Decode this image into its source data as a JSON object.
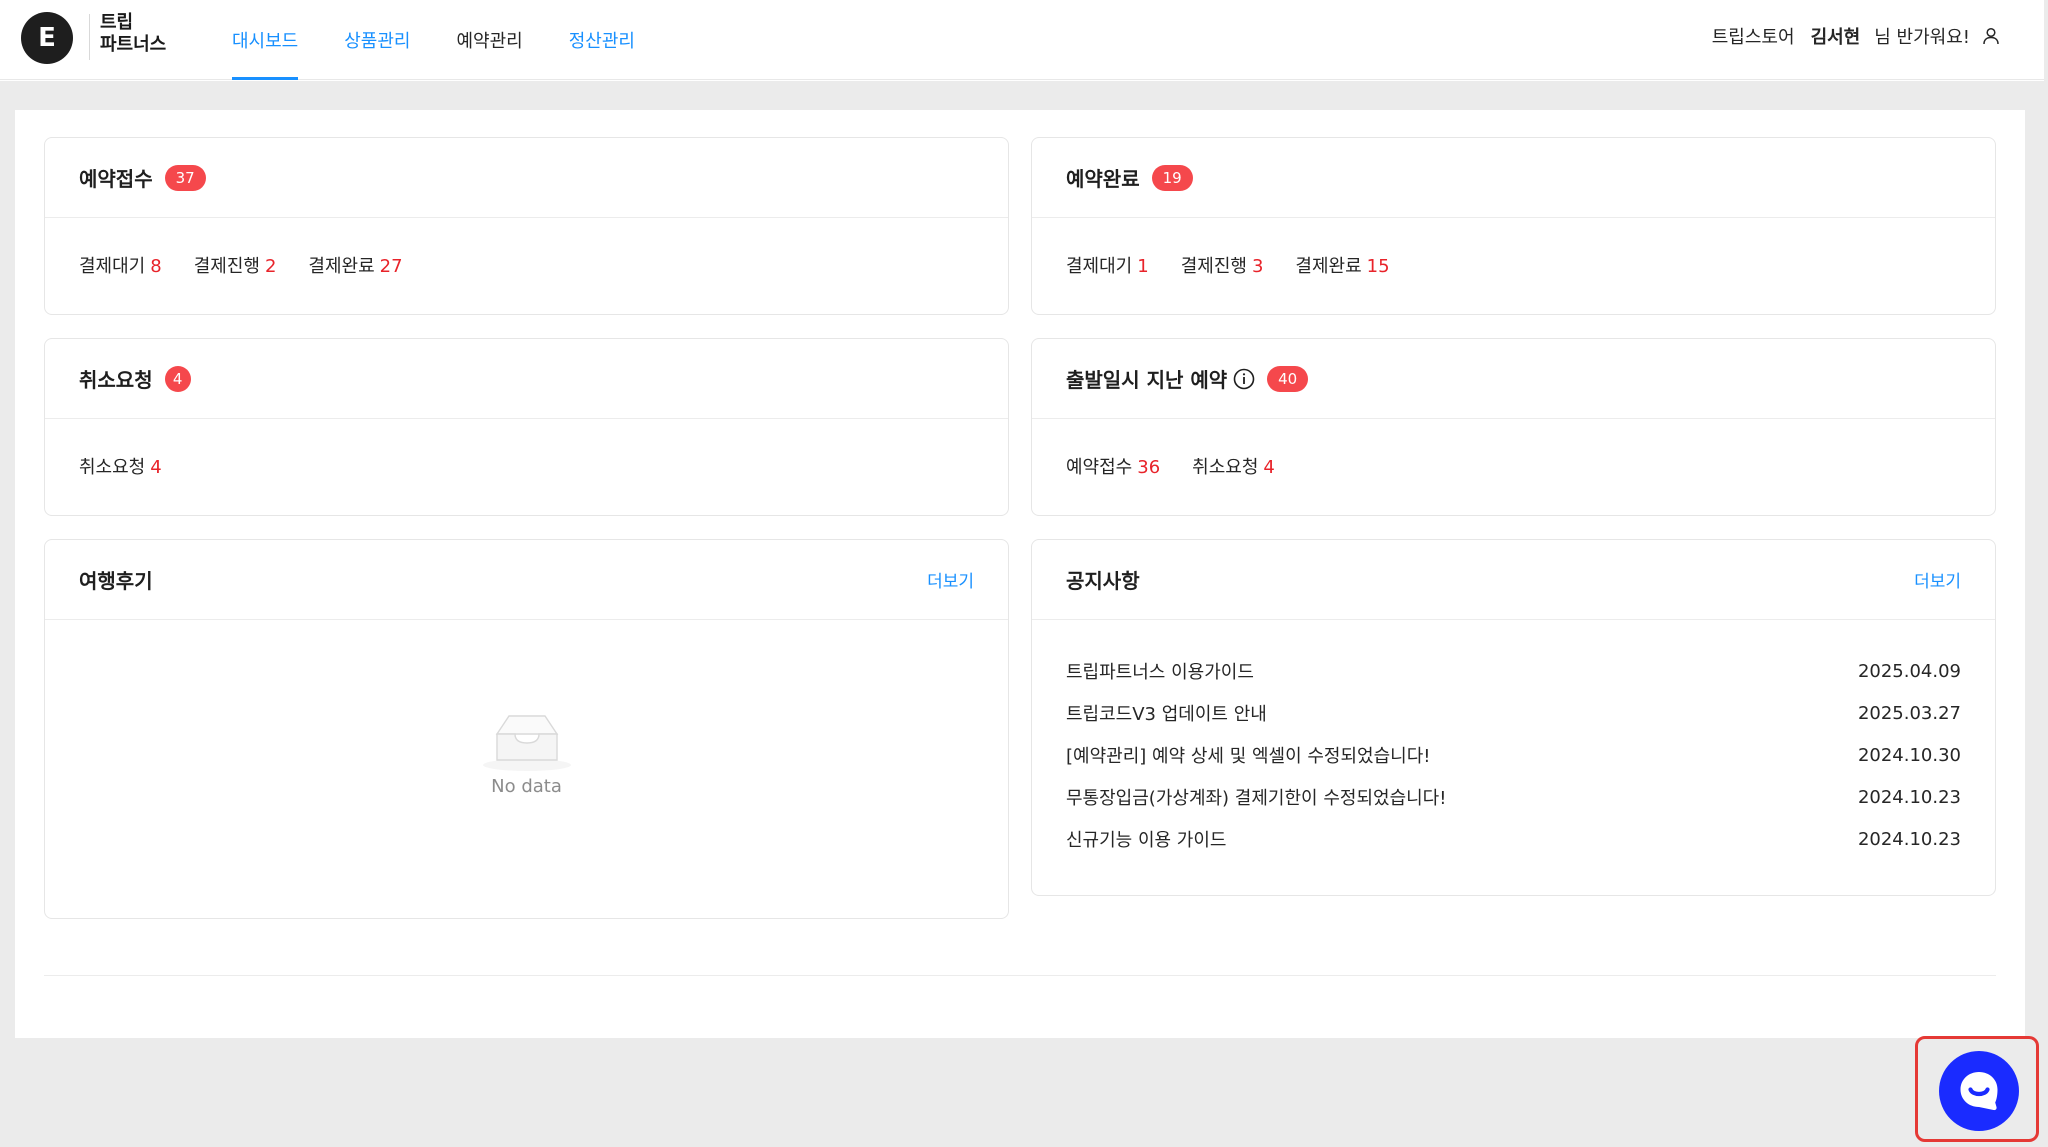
{
  "header": {
    "logo_letter": "E",
    "logo_line1": "트립",
    "logo_line2": "파트너스",
    "nav": [
      {
        "label": "대시보드",
        "active": true
      },
      {
        "label": "상품관리"
      },
      {
        "label": "예약관리"
      },
      {
        "label": "정산관리"
      }
    ],
    "store": "트립스토어",
    "user_name": "김서현",
    "greeting": "님 반가워요!",
    "user_icon": "user-icon"
  },
  "cards": {
    "reception": {
      "title": "예약접수",
      "badge": "37",
      "stats": [
        {
          "label": "결제대기",
          "value": "8"
        },
        {
          "label": "결제진행",
          "value": "2"
        },
        {
          "label": "결제완료",
          "value": "27"
        }
      ]
    },
    "completed": {
      "title": "예약완료",
      "badge": "19",
      "stats": [
        {
          "label": "결제대기",
          "value": "1"
        },
        {
          "label": "결제진행",
          "value": "3"
        },
        {
          "label": "결제완료",
          "value": "15"
        }
      ]
    },
    "cancel": {
      "title": "취소요청",
      "badge": "4",
      "stats": [
        {
          "label": "취소요청",
          "value": "4"
        }
      ]
    },
    "past": {
      "title": "출발일시 지난 예약",
      "badge": "40",
      "info_icon": "info-icon",
      "stats": [
        {
          "label": "예약접수",
          "value": "36"
        },
        {
          "label": "취소요청",
          "value": "4"
        }
      ]
    },
    "reviews": {
      "title": "여행후기",
      "more": "더보기",
      "empty_label": "No data",
      "empty_icon": "inbox-icon"
    },
    "notices": {
      "title": "공지사항",
      "more": "더보기",
      "items": [
        {
          "title": "트립파트너스 이용가이드",
          "date": "2025.04.09"
        },
        {
          "title": "트립코드V3 업데이트 안내",
          "date": "2025.03.27"
        },
        {
          "title": "[예약관리] 예약 상세 및 엑셀이 수정되었습니다!",
          "date": "2024.10.30"
        },
        {
          "title": "무통장입금(가상계좌) 결제기한이 수정되었습니다!",
          "date": "2024.10.23"
        },
        {
          "title": "신규기능 이용 가이드",
          "date": "2024.10.23"
        }
      ]
    }
  },
  "chat": {
    "icon": "chat-icon",
    "color": "#1a2bff"
  },
  "colors": {
    "accent": "#1890ff",
    "badge": "#f5484c",
    "count": "#e8232a"
  }
}
